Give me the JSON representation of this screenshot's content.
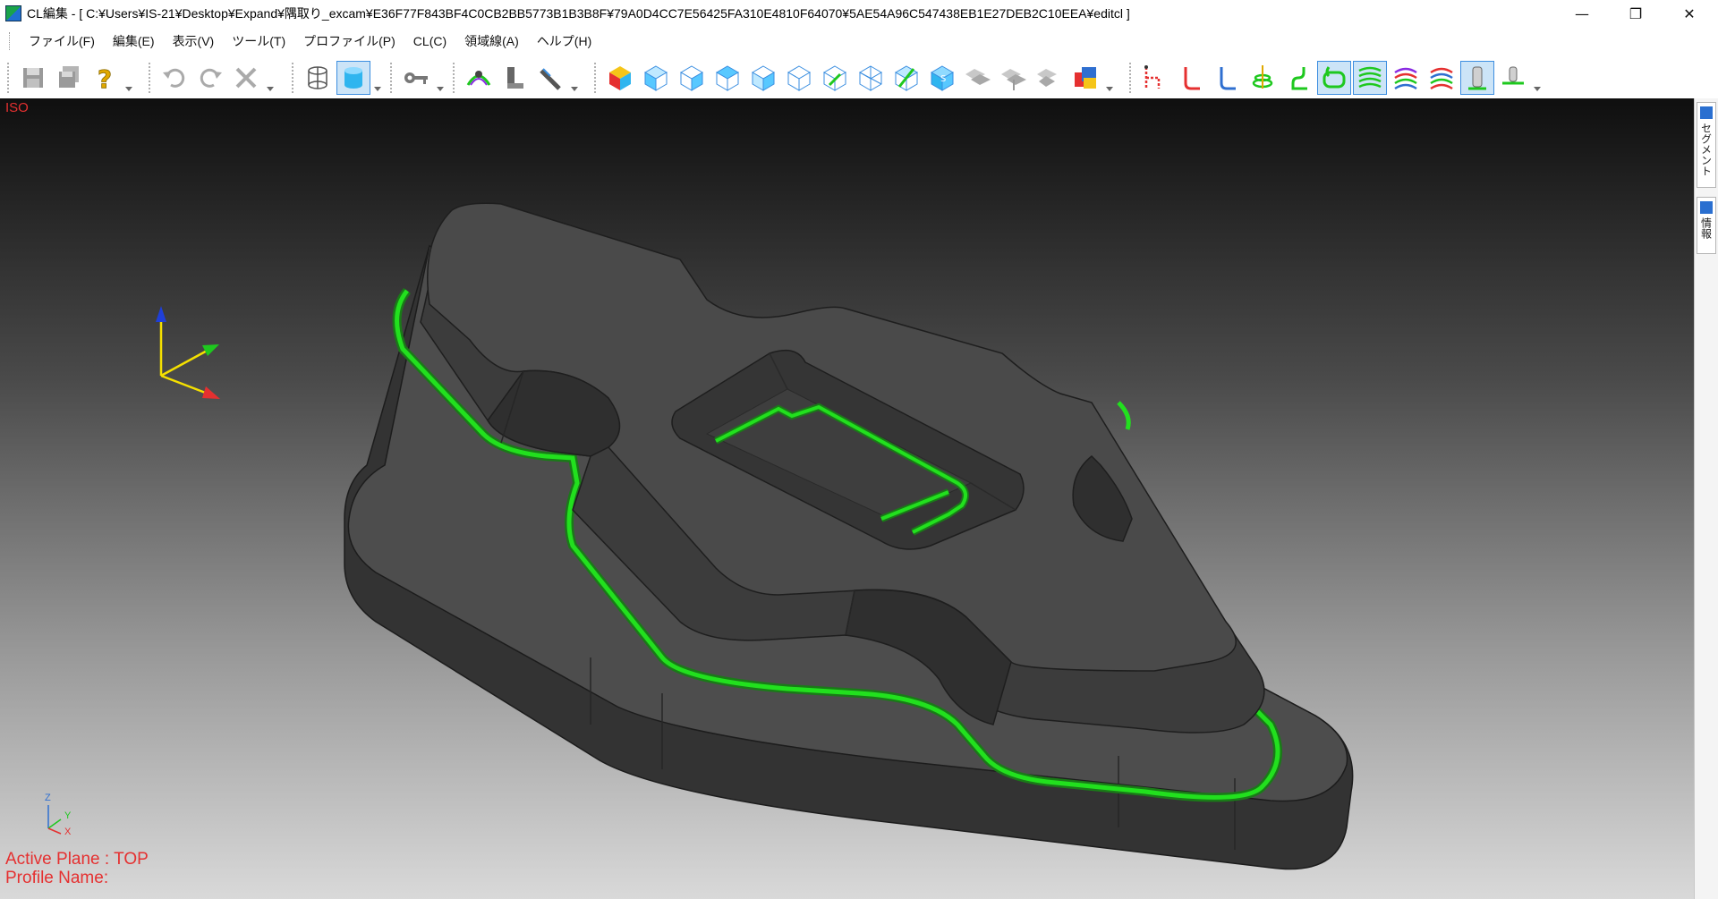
{
  "window": {
    "title": "CL編集 - [ C:¥Users¥IS-21¥Desktop¥Expand¥隅取り_excam¥E36F77F843BF4C0CB2BB5773B1B3B8F¥79A0D4CC7E56425FA310E4810F64070¥5AE54A96C547438EB1E27DEB2C10EEA¥editcl ]",
    "minimize": "—",
    "restore": "❐",
    "close": "✕"
  },
  "menu": [
    {
      "label": "ファイル(F)"
    },
    {
      "label": "編集(E)"
    },
    {
      "label": "表示(V)"
    },
    {
      "label": "ツール(T)"
    },
    {
      "label": "プロファイル(P)"
    },
    {
      "label": "CL(C)"
    },
    {
      "label": "領域線(A)"
    },
    {
      "label": "ヘルプ(H)"
    }
  ],
  "toolbar_icons": [
    "save-icon",
    "save-all-icon",
    "help-icon",
    "undo-icon",
    "redo-icon",
    "delete-icon",
    "wireframe-cylinder-icon",
    "solid-cylinder-icon",
    "key-tool-icon",
    "toolpath-check-icon",
    "tool-holder-icon",
    "measure-icon",
    "view-iso-color-icon",
    "view-front-icon",
    "view-back-icon",
    "view-left-icon",
    "view-right-icon",
    "view-top-icon",
    "view-bottom-icon",
    "view-axo-icon",
    "view-fit-icon",
    "view-box-icon",
    "view-shade-1-icon",
    "view-shade-2-icon",
    "view-shade-3-icon",
    "color-palette-icon",
    "cl-point-icon",
    "cl-approach-icon",
    "cl-retract-icon",
    "cl-spiral-icon",
    "cl-link-icon",
    "cl-offset-icon",
    "cl-zigzag-icon",
    "cl-multicolor-1-icon",
    "cl-multicolor-2-icon",
    "cl-tool-icon",
    "cl-tool-tip-icon"
  ],
  "viewport": {
    "view_label": "ISO",
    "active_plane": "Active Plane : TOP",
    "profile_name": "Profile Name:",
    "axis_x": "X",
    "axis_y": "Y",
    "axis_z": "Z"
  },
  "side_panel": [
    {
      "label": "セグメント"
    },
    {
      "label": "情報"
    }
  ],
  "colors": {
    "toolpath": "#22e01e",
    "status_text": "#e53030",
    "part_surface": "#4a4a4a"
  }
}
